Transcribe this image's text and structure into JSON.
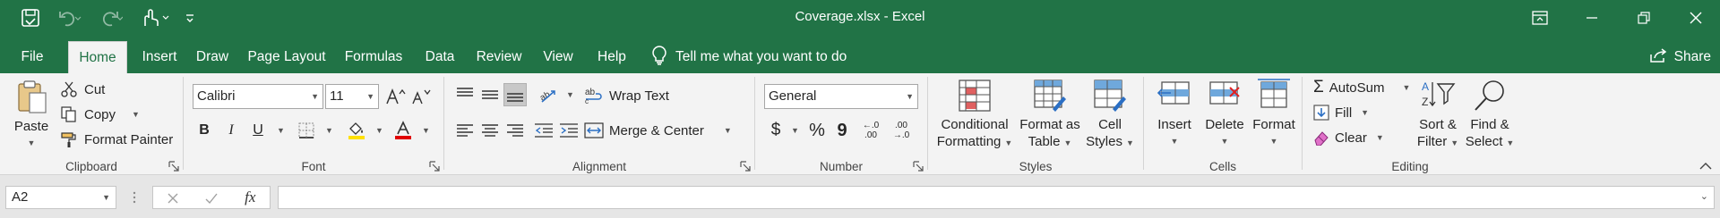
{
  "window": {
    "title": "Coverage.xlsx  -  Excel"
  },
  "tabs": [
    {
      "label": "File"
    },
    {
      "label": "Home"
    },
    {
      "label": "Insert"
    },
    {
      "label": "Draw"
    },
    {
      "label": "Page Layout"
    },
    {
      "label": "Formulas"
    },
    {
      "label": "Data"
    },
    {
      "label": "Review"
    },
    {
      "label": "View"
    },
    {
      "label": "Help"
    }
  ],
  "tell_me": "Tell me what you want to do",
  "share": "Share",
  "clipboard": {
    "group": "Clipboard",
    "paste": "Paste",
    "cut": "Cut",
    "copy": "Copy",
    "format_painter": "Format Painter"
  },
  "font": {
    "group": "Font",
    "name": "Calibri",
    "size": "11",
    "bold": "B",
    "italic": "I",
    "underline": "U",
    "fill_color": "#ffe000",
    "font_color": "#e00000"
  },
  "alignment": {
    "group": "Alignment",
    "wrap_text": "Wrap Text",
    "merge_center": "Merge & Center"
  },
  "number": {
    "group": "Number",
    "format": "General",
    "currency": "$",
    "percent": "%",
    "comma": "9",
    "inc_decimal": "←.0 .00",
    "dec_decimal": ".00 →.0"
  },
  "styles": {
    "group": "Styles",
    "conditional": [
      "Conditional",
      "Formatting"
    ],
    "format_table": [
      "Format as",
      "Table"
    ],
    "cell_styles": [
      "Cell",
      "Styles"
    ]
  },
  "cells": {
    "group": "Cells",
    "insert": "Insert",
    "delete": "Delete",
    "format": "Format"
  },
  "editing": {
    "group": "Editing",
    "autosum": "AutoSum",
    "fill": "Fill",
    "clear": "Clear",
    "sort_filter": [
      "Sort &",
      "Filter"
    ],
    "find_select": [
      "Find &",
      "Select"
    ]
  },
  "formula_bar": {
    "name_box": "A2",
    "fx": "fx",
    "value": ""
  }
}
